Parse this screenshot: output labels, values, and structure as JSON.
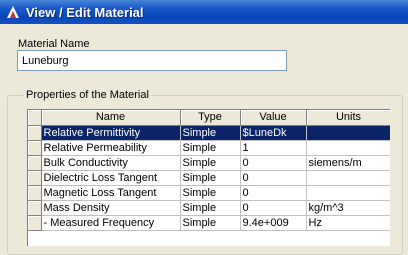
{
  "window": {
    "title": "View / Edit Material"
  },
  "material": {
    "label": "Material Name",
    "value": "Luneburg"
  },
  "properties": {
    "group_label": "Properties of the Material",
    "headers": {
      "name": "Name",
      "type": "Type",
      "value": "Value",
      "units": "Units"
    },
    "rows": [
      {
        "name": "Relative Permittivity",
        "type": "Simple",
        "value": "$LuneDk",
        "units": ""
      },
      {
        "name": "Relative Permeability",
        "type": "Simple",
        "value": "1",
        "units": ""
      },
      {
        "name": "Bulk Conductivity",
        "type": "Simple",
        "value": "0",
        "units": "siemens/m"
      },
      {
        "name": "Dielectric Loss Tangent",
        "type": "Simple",
        "value": "0",
        "units": ""
      },
      {
        "name": "Magnetic Loss Tangent",
        "type": "Simple",
        "value": "0",
        "units": ""
      },
      {
        "name": "Mass Density",
        "type": "Simple",
        "value": "0",
        "units": "kg/m^3"
      },
      {
        "name": "- Measured Frequency",
        "type": "Simple",
        "value": "9.4e+009",
        "units": "Hz"
      }
    ]
  },
  "icons": {
    "app": "app-logo-icon"
  },
  "colors": {
    "titlebar": "#0a46b8",
    "selection": "#0a246a"
  }
}
